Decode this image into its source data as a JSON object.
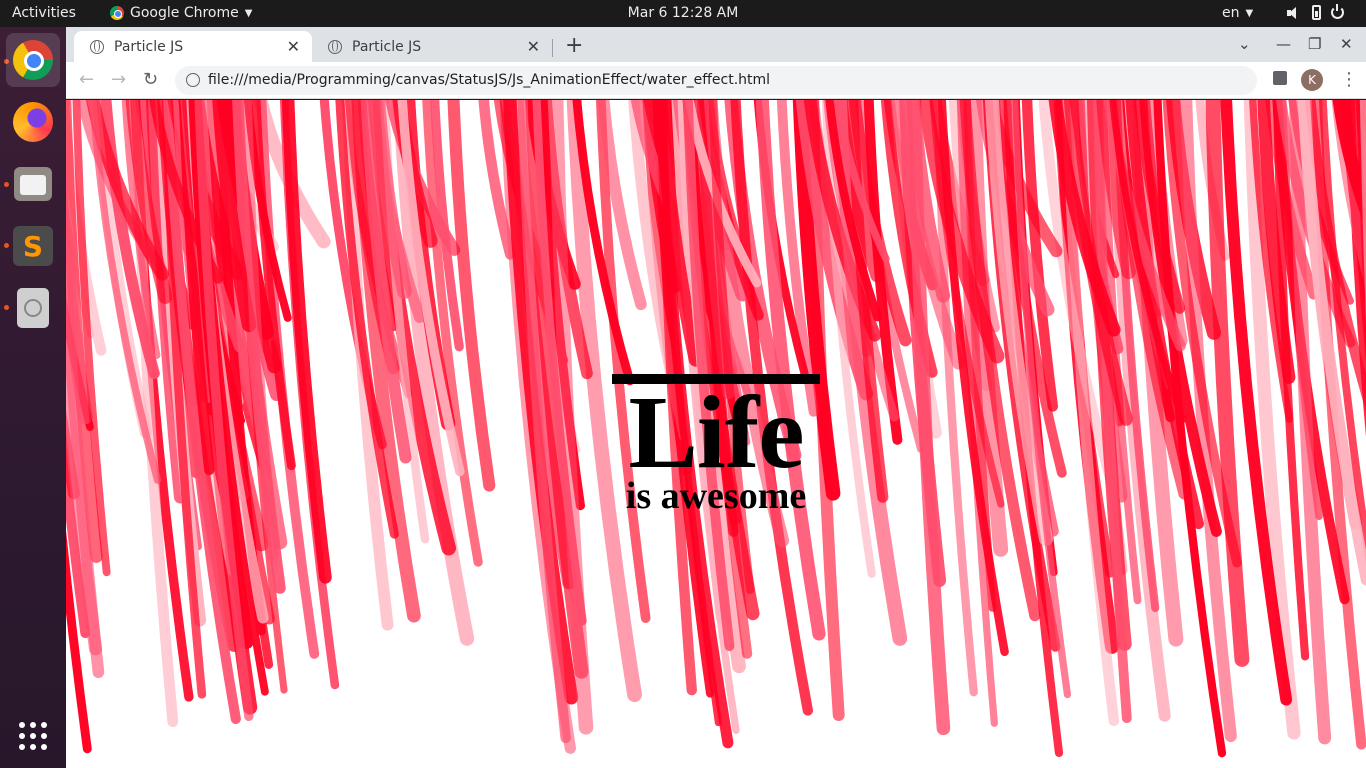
{
  "topbar": {
    "activities": "Activities",
    "app_name": "Google Chrome",
    "clock": "Mar 6  12:28 AM",
    "lang": "en"
  },
  "dock": {
    "items": [
      "chrome",
      "firefox",
      "files",
      "sublime-text",
      "disc-utility"
    ],
    "show_apps_icon": "apps-grid-icon"
  },
  "browser": {
    "tabs": [
      {
        "title": "Particle JS",
        "active": true
      },
      {
        "title": "Particle JS",
        "active": false
      }
    ],
    "url": "file:///media/Programming/canvas/StatusJS/Js_AnimationEffect/water_effect.html",
    "profile_initial": "K"
  },
  "page": {
    "headline": "Life",
    "subheadline": "is awesome",
    "colors": {
      "particle_red": "#ff0022",
      "particle_pink": "#ff4d6d",
      "particle_light": "#ffb3bf",
      "background": "#ffffff"
    }
  }
}
